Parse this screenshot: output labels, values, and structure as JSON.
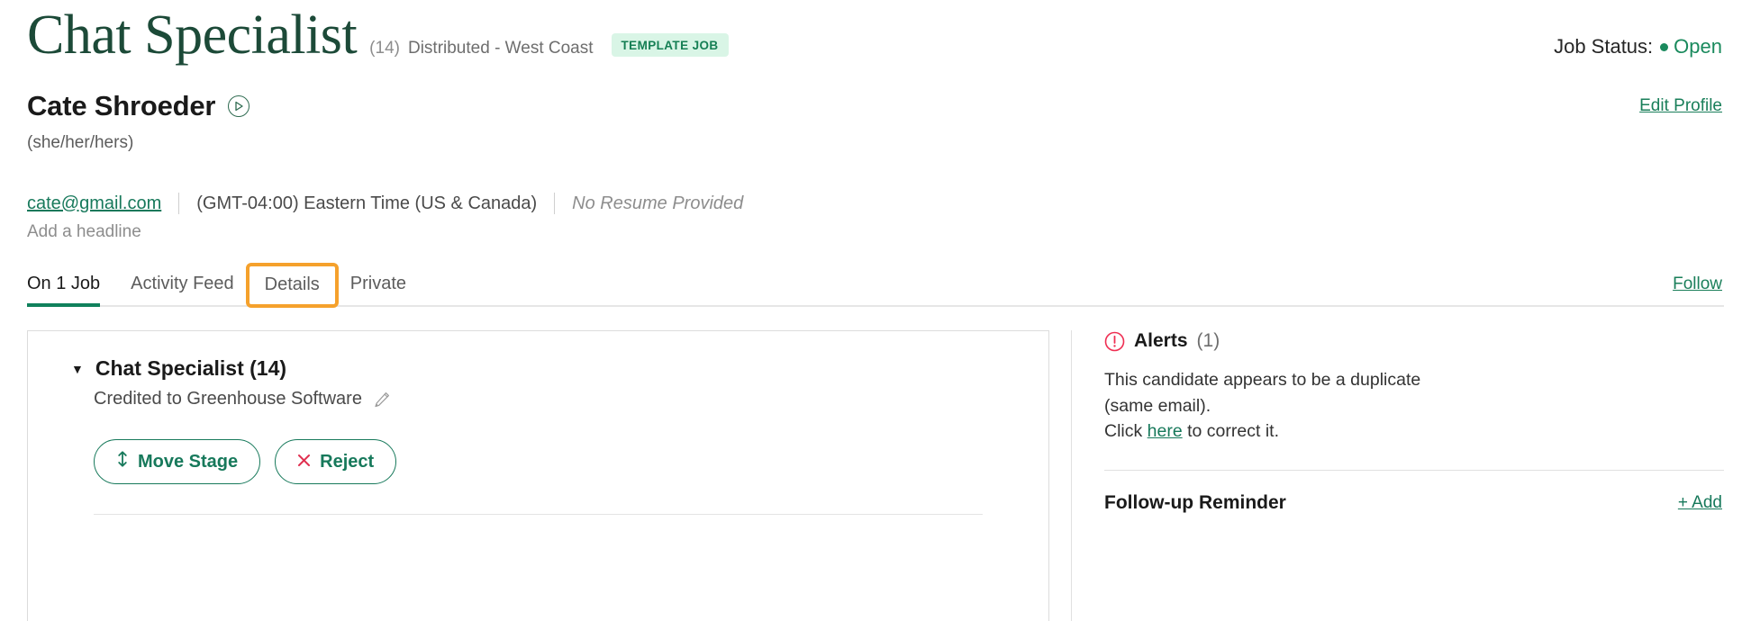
{
  "header": {
    "job_title": "Chat Specialist",
    "job_count": "(14)",
    "office": "Distributed - West Coast",
    "template_badge": "TEMPLATE JOB",
    "job_status_label": "Job Status:",
    "job_status_value": "Open",
    "job_status_color": "#1a8a5d"
  },
  "candidate": {
    "name": "Cate Shroeder",
    "pronouns": "(she/her/hers)",
    "edit_profile_label": "Edit Profile",
    "email": "cate@gmail.com",
    "timezone": "(GMT-04:00) Eastern Time (US & Canada)",
    "resume": "No Resume Provided",
    "headline_placeholder": "Add a headline"
  },
  "tabs": {
    "items": [
      {
        "label": "On 1 Job",
        "active": true,
        "highlighted": false
      },
      {
        "label": "Activity Feed",
        "active": false,
        "highlighted": false
      },
      {
        "label": "Details",
        "active": false,
        "highlighted": true
      },
      {
        "label": "Private",
        "active": false,
        "highlighted": false
      }
    ],
    "follow_label": "Follow",
    "highlight_color": "#f5a12c",
    "active_underline_color": "#10815c"
  },
  "stage_card": {
    "title": "Chat Specialist (14)",
    "credited_text": "Credited to Greenhouse Software",
    "move_stage_label": "Move Stage",
    "reject_label": "Reject",
    "accent_color": "#17795b",
    "reject_icon_color": "#e03050"
  },
  "sidebar": {
    "alerts_title": "Alerts",
    "alerts_count": "(1)",
    "alert_text_line1": "This candidate appears to be a duplicate (same",
    "alert_text_line2": "email).",
    "alert_click_prefix": "Click ",
    "alert_link_label": "here",
    "alert_click_suffix": " to correct it.",
    "followup_title": "Follow-up Reminder",
    "add_label": "+ Add",
    "alert_icon_color": "#ef2e52"
  }
}
